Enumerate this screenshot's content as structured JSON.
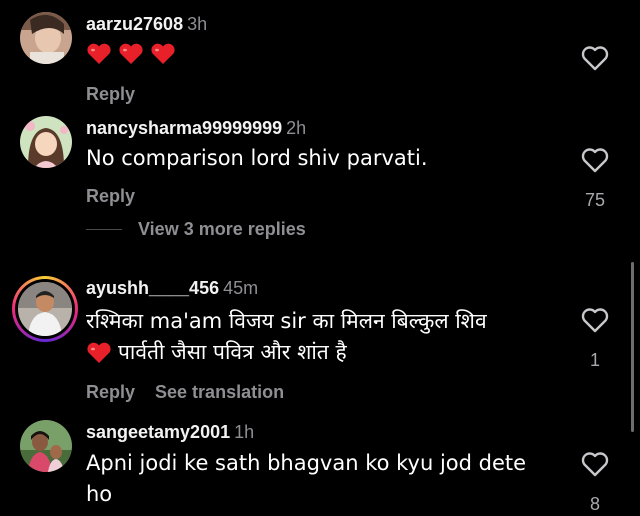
{
  "comments": [
    {
      "username": "aarzu27608",
      "time": "3h",
      "text": "",
      "emoji_count": 3,
      "reply_label": "Reply",
      "likes": ""
    },
    {
      "username": "nancysharma99999999",
      "time": "2h",
      "text": "No comparison lord shiv parvati.",
      "reply_label": "Reply",
      "likes": "75",
      "view_more": "View 3 more replies"
    },
    {
      "username": "ayushh____456",
      "time": "45m",
      "text_line1": "रश्मिका ma'am विजय sir का मिलन बिल्कुल शिव",
      "text_line2": "पार्वती जैसा पवित्र और शांत है",
      "reply_label": "Reply",
      "translate_label": "See translation",
      "likes": "1"
    },
    {
      "username": "sangeetamy2001",
      "time": "1h",
      "text_line1": "Apni jodi ke sath bhagvan ko kyu jod dete",
      "text_line2": "ho",
      "likes": "8"
    }
  ],
  "icons": {
    "like": "heart-outline-icon",
    "emoji": "red-heart-emoji",
    "heart_color": "#e8202a"
  }
}
